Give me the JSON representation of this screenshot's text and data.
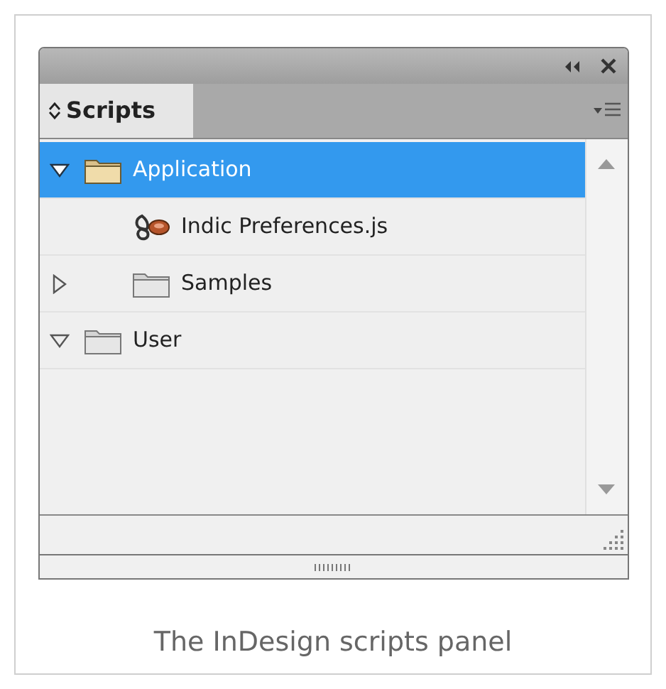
{
  "panel": {
    "tab": {
      "label": "Scripts",
      "selected": true
    },
    "tree": [
      {
        "label": "Application",
        "kind": "folder",
        "expanded": true,
        "selected": true,
        "children": [
          {
            "label": "Indic Preferences.js",
            "kind": "script",
            "selected": false
          },
          {
            "label": "Samples",
            "kind": "folder",
            "expanded": false,
            "selected": false
          }
        ]
      },
      {
        "label": "User",
        "kind": "folder",
        "expanded": true,
        "selected": false
      }
    ]
  },
  "caption": "The InDesign scripts panel"
}
